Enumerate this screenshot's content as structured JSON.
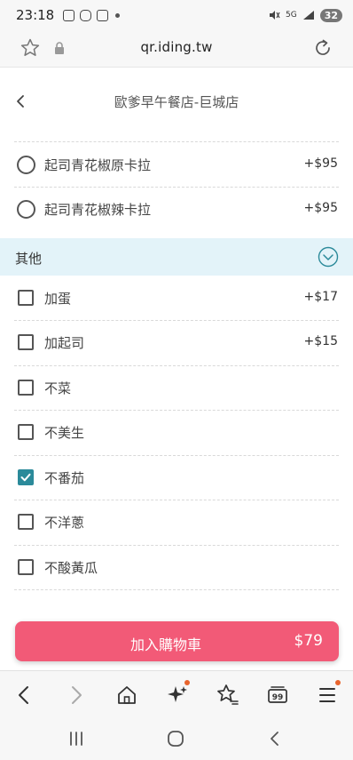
{
  "status_bar": {
    "time": "23:18",
    "network": "5G",
    "battery": "32"
  },
  "browser": {
    "url": "qr.iding.tw"
  },
  "header": {
    "store_name": "歐爹早午餐店-巨城店"
  },
  "options_top": [
    {
      "label": "起司青花椒原卡拉",
      "price": "+$95",
      "selected": false
    },
    {
      "label": "起司青花椒辣卡拉",
      "price": "+$95",
      "selected": false
    }
  ],
  "section": {
    "title": "其他"
  },
  "extras": [
    {
      "label": "加蛋",
      "price": "+$17",
      "checked": false
    },
    {
      "label": "加起司",
      "price": "+$15",
      "checked": false
    },
    {
      "label": "不菜",
      "price": "",
      "checked": false
    },
    {
      "label": "不美生",
      "price": "",
      "checked": false
    },
    {
      "label": "不番茄",
      "price": "",
      "checked": true
    },
    {
      "label": "不洋蔥",
      "price": "",
      "checked": false
    },
    {
      "label": "不酸黃瓜",
      "price": "",
      "checked": false
    }
  ],
  "cart": {
    "label": "加入購物車",
    "total": "$79"
  },
  "toolbar": {
    "tabs_count": "99"
  },
  "colors": {
    "accent_teal": "#2b8a9a",
    "cart_pink": "#f25a77",
    "section_bg": "#e3f3f9",
    "badge_orange": "#e8642c"
  }
}
